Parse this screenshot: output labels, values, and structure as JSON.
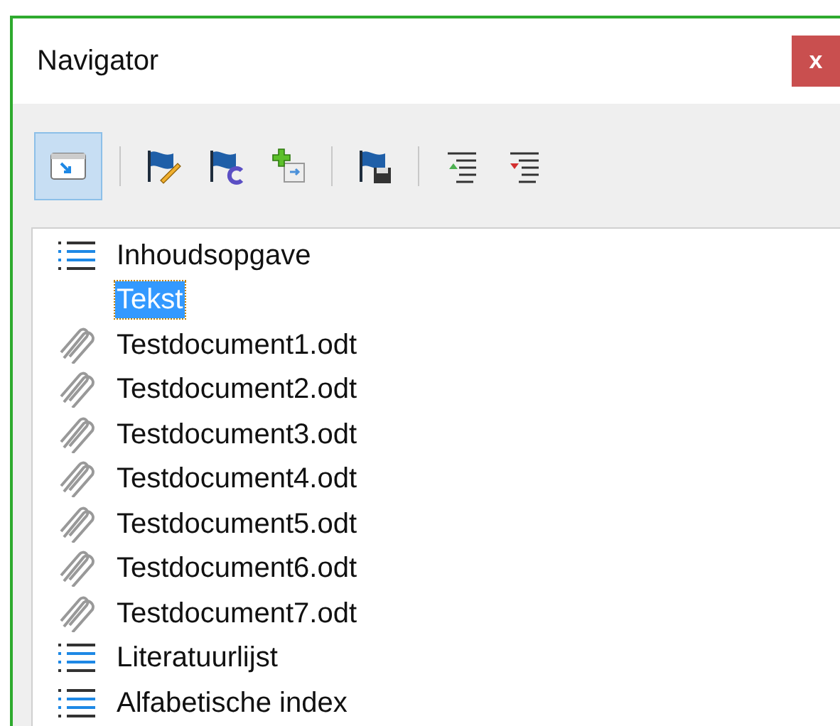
{
  "window": {
    "title": "Navigator",
    "close": "x"
  },
  "toolbar": [
    {
      "kind": "window",
      "selected": true
    },
    {
      "kind": "separator"
    },
    {
      "kind": "edit",
      "selected": false
    },
    {
      "kind": "refresh",
      "selected": false
    },
    {
      "kind": "insert",
      "selected": false
    },
    {
      "kind": "separator"
    },
    {
      "kind": "save",
      "selected": false
    },
    {
      "kind": "separator"
    },
    {
      "kind": "promote",
      "selected": false
    },
    {
      "kind": "demote",
      "selected": false
    }
  ],
  "tree": [
    {
      "kind": "index",
      "label": "Inhoudsopgave",
      "selected": false
    },
    {
      "kind": "text",
      "label": "Tekst",
      "selected": true
    },
    {
      "kind": "document",
      "label": "Testdocument1.odt",
      "selected": false
    },
    {
      "kind": "document",
      "label": "Testdocument2.odt",
      "selected": false
    },
    {
      "kind": "document",
      "label": "Testdocument3.odt",
      "selected": false
    },
    {
      "kind": "document",
      "label": "Testdocument4.odt",
      "selected": false
    },
    {
      "kind": "document",
      "label": "Testdocument5.odt",
      "selected": false
    },
    {
      "kind": "document",
      "label": "Testdocument6.odt",
      "selected": false
    },
    {
      "kind": "document",
      "label": "Testdocument7.odt",
      "selected": false
    },
    {
      "kind": "index",
      "label": "Literatuurlijst",
      "selected": false
    },
    {
      "kind": "index",
      "label": "Alfabetische index",
      "selected": false
    }
  ]
}
